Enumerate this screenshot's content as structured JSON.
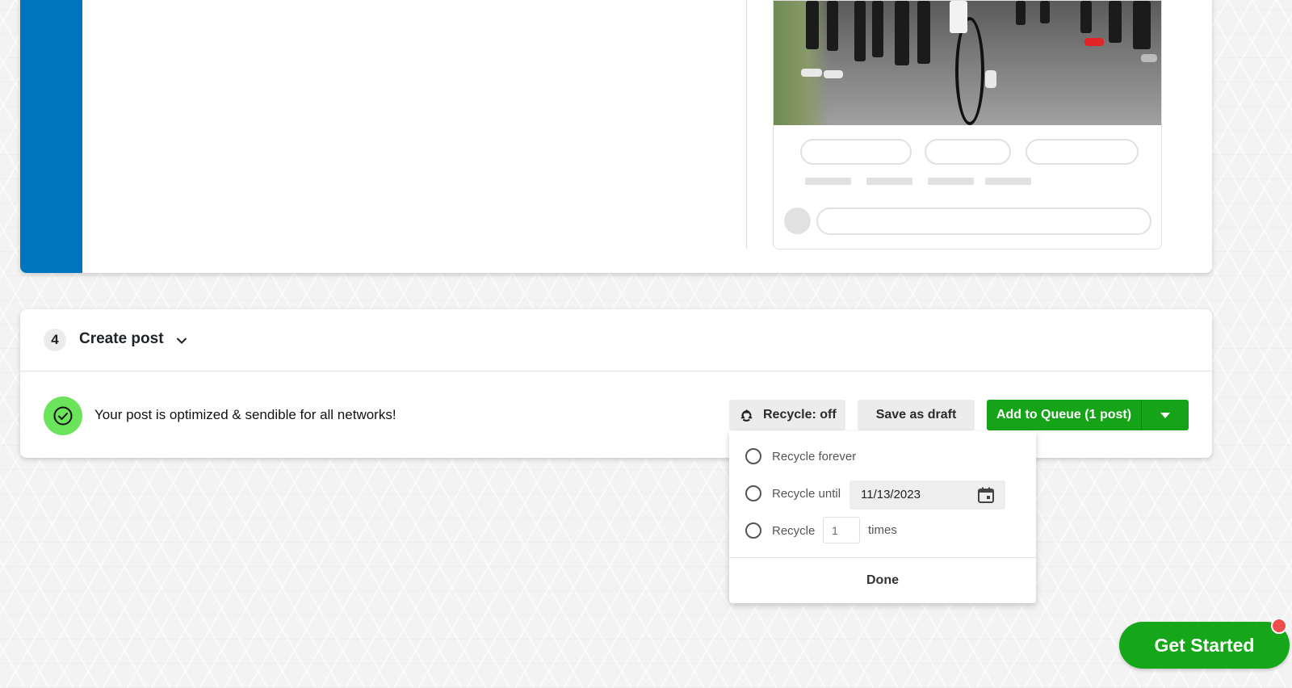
{
  "step": {
    "number": "4",
    "title": "Create post"
  },
  "status": {
    "message": "Your post is optimized & sendible for all networks!",
    "icon": "check-circle-icon",
    "color": "#6be35b"
  },
  "actions": {
    "recycle_label": "Recycle: off",
    "draft_label": "Save as draft",
    "queue_label": "Add to Queue (1 post)",
    "queue_color": "#15a317"
  },
  "recycle_menu": {
    "option_forever": "Recycle forever",
    "option_until": "Recycle until",
    "until_date": "11/13/2023",
    "option_times_prefix": "Recycle",
    "times_value": "1",
    "option_times_suffix": "times",
    "done_label": "Done"
  },
  "cta": {
    "label": "Get Started"
  },
  "colors": {
    "sidebar_accent": "#0075be",
    "notification": "#f04d4d"
  }
}
